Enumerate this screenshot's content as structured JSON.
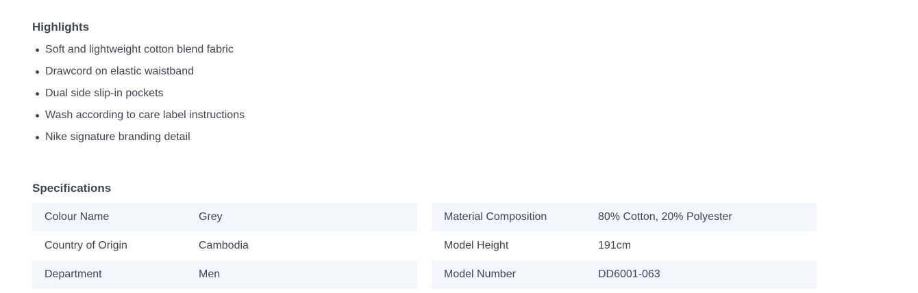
{
  "highlights": {
    "title": "Highlights",
    "items": [
      "Soft and lightweight cotton blend fabric",
      "Drawcord on elastic waistband",
      "Dual side slip-in pockets",
      "Wash according to care label instructions",
      "Nike signature branding detail"
    ]
  },
  "specifications": {
    "title": "Specifications",
    "left": [
      {
        "label": "Colour Name",
        "value": "Grey"
      },
      {
        "label": "Country of Origin",
        "value": "Cambodia"
      },
      {
        "label": "Department",
        "value": "Men"
      }
    ],
    "right": [
      {
        "label": "Material Composition",
        "value": "80% Cotton, 20% Polyester"
      },
      {
        "label": "Model Height",
        "value": "191cm"
      },
      {
        "label": "Model Number",
        "value": "DD6001-063"
      }
    ]
  },
  "colors": {
    "text": "#404553",
    "row_shade": "#f3f6fb",
    "background": "#ffffff"
  }
}
